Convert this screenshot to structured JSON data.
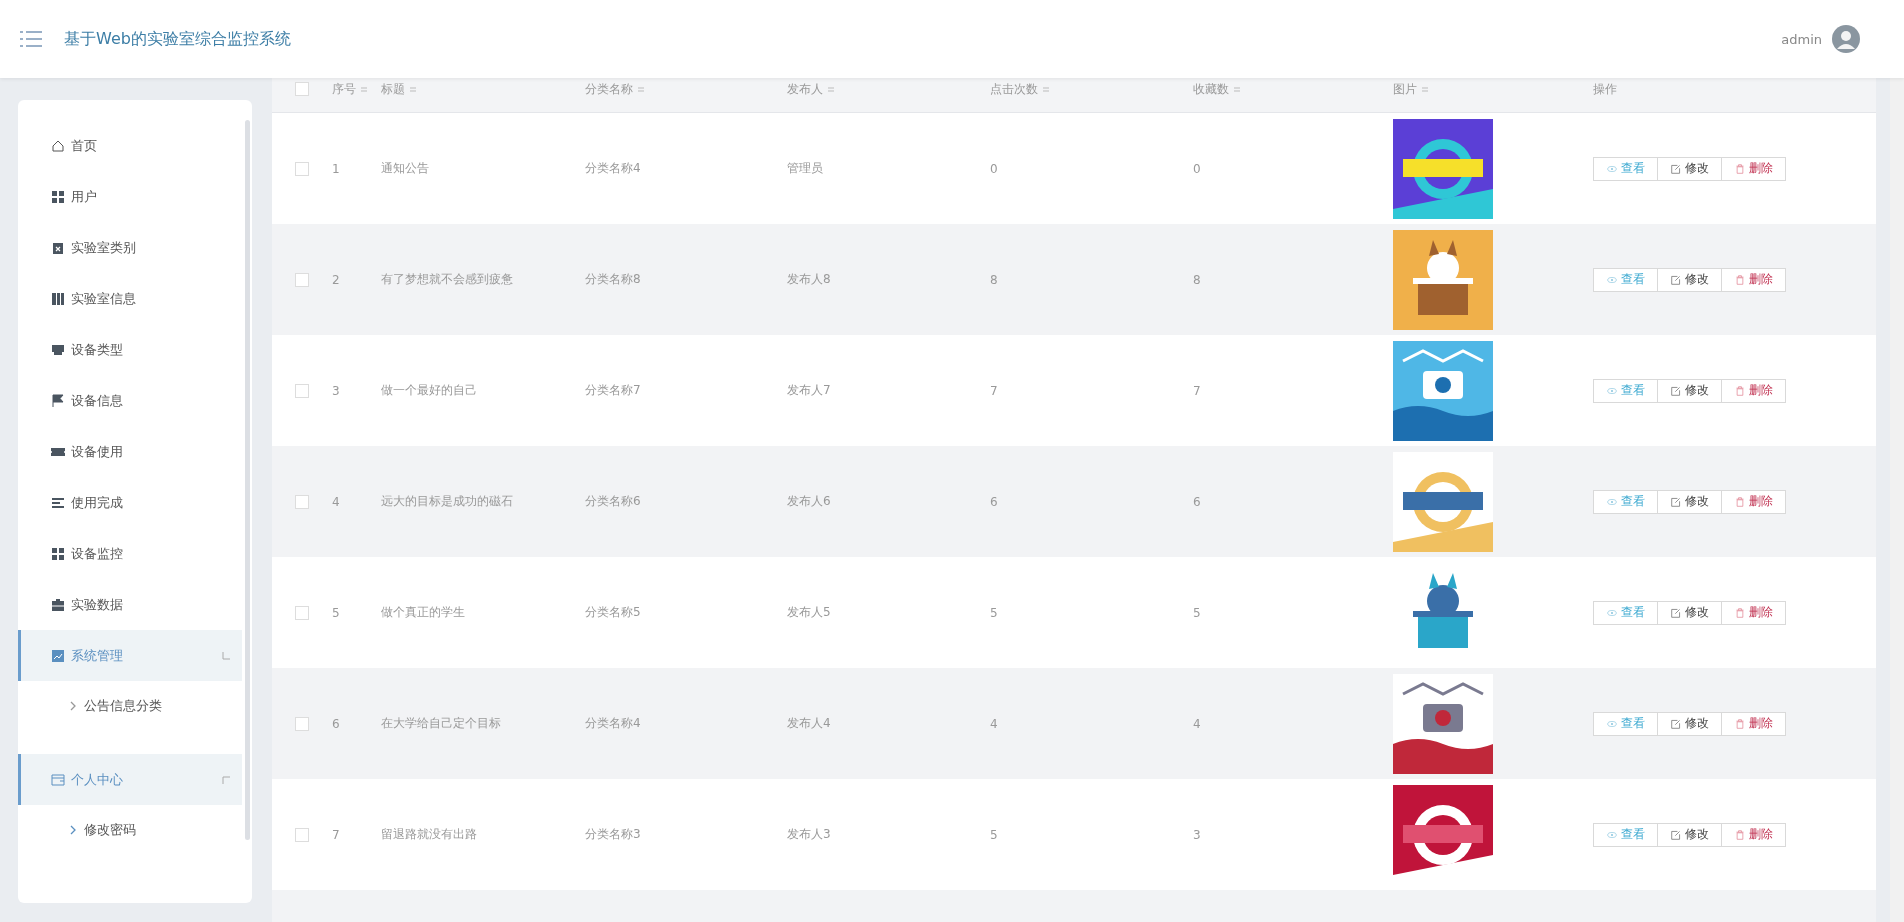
{
  "header": {
    "title": "基于Web的实验室综合监控系统",
    "user": "admin"
  },
  "sidebar": {
    "items": [
      {
        "label": "首页",
        "expanded": false
      },
      {
        "label": "用户",
        "expanded": false
      },
      {
        "label": "实验室类别",
        "expanded": false
      },
      {
        "label": "实验室信息",
        "expanded": false
      },
      {
        "label": "设备类型",
        "expanded": false
      },
      {
        "label": "设备信息",
        "expanded": false
      },
      {
        "label": "设备使用",
        "expanded": false
      },
      {
        "label": "使用完成",
        "expanded": false
      },
      {
        "label": "设备监控",
        "expanded": false
      },
      {
        "label": "实验数据",
        "expanded": false
      },
      {
        "label": "系统管理",
        "expanded": true,
        "children": [
          {
            "label": "公告信息分类"
          }
        ]
      },
      {
        "label": "个人中心",
        "expanded": true,
        "children": [
          {
            "label": "修改密码"
          }
        ]
      }
    ]
  },
  "table": {
    "all_checked": false,
    "columns": [
      "序号",
      "标题",
      "分类名称",
      "发布人",
      "点击次数",
      "收藏数",
      "图片",
      "操作"
    ],
    "rows": [
      {
        "checked": false,
        "cells": [
          "1",
          "通知公告",
          "分类名称4",
          "管理员",
          "0",
          "0"
        ],
        "actions": [
          "查看",
          "修改",
          "删除"
        ]
      },
      {
        "checked": false,
        "cells": [
          "2",
          "有了梦想就不会感到疲惫",
          "分类名称8",
          "发布人8",
          "8",
          "8"
        ],
        "actions": [
          "查看",
          "修改",
          "删除"
        ]
      },
      {
        "checked": false,
        "cells": [
          "3",
          "做一个最好的自己",
          "分类名称7",
          "发布人7",
          "7",
          "7"
        ],
        "actions": [
          "查看",
          "修改",
          "删除"
        ]
      },
      {
        "checked": false,
        "cells": [
          "4",
          "远大的目标是成功的磁石",
          "分类名称6",
          "发布人6",
          "6",
          "6"
        ],
        "actions": [
          "查看",
          "修改",
          "删除"
        ]
      },
      {
        "checked": false,
        "cells": [
          "5",
          "做个真正的学生",
          "分类名称5",
          "发布人5",
          "5",
          "5"
        ],
        "actions": [
          "查看",
          "修改",
          "删除"
        ]
      },
      {
        "checked": false,
        "cells": [
          "6",
          "在大学给自己定个目标",
          "分类名称4",
          "发布人4",
          "4",
          "4"
        ],
        "actions": [
          "查看",
          "修改",
          "删除"
        ]
      },
      {
        "checked": false,
        "cells": [
          "7",
          "留退路就没有出路",
          "分类名称3",
          "发布人3",
          "5",
          "3"
        ],
        "actions": [
          "查看",
          "修改",
          "删除"
        ]
      }
    ]
  }
}
